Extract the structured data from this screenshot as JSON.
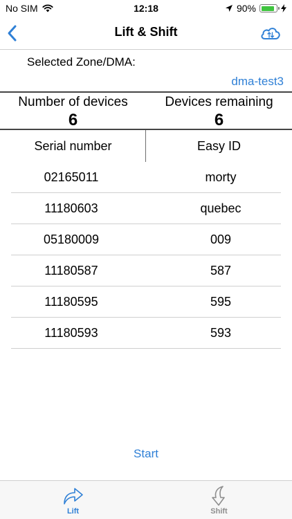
{
  "status_bar": {
    "carrier": "No SIM",
    "time": "12:18",
    "battery_percent": "90%",
    "battery_level": 0.9,
    "battery_color": "#3fc43f"
  },
  "nav": {
    "title": "Lift & Shift",
    "back_icon": "chevron-left-icon",
    "action_icon": "cloud-sync-icon",
    "accent_color": "#2f80d6"
  },
  "zone": {
    "label": "Selected Zone/DMA:",
    "value": "dma-test3"
  },
  "counts": {
    "number_label": "Number of devices",
    "number_value": "6",
    "remaining_label": "Devices remaining",
    "remaining_value": "6"
  },
  "table": {
    "headers": [
      "Serial number",
      "Easy ID"
    ],
    "rows": [
      {
        "serial": "02165011",
        "easy_id": "morty"
      },
      {
        "serial": "11180603",
        "easy_id": "quebec"
      },
      {
        "serial": "05180009",
        "easy_id": "009"
      },
      {
        "serial": "11180587",
        "easy_id": "587"
      },
      {
        "serial": "11180595",
        "easy_id": "595"
      },
      {
        "serial": "11180593",
        "easy_id": "593"
      }
    ]
  },
  "actions": {
    "start_label": "Start"
  },
  "tabs": [
    {
      "label": "Lift",
      "icon": "lift-arrow-icon",
      "active": true
    },
    {
      "label": "Shift",
      "icon": "shift-arrow-icon",
      "active": false
    }
  ]
}
